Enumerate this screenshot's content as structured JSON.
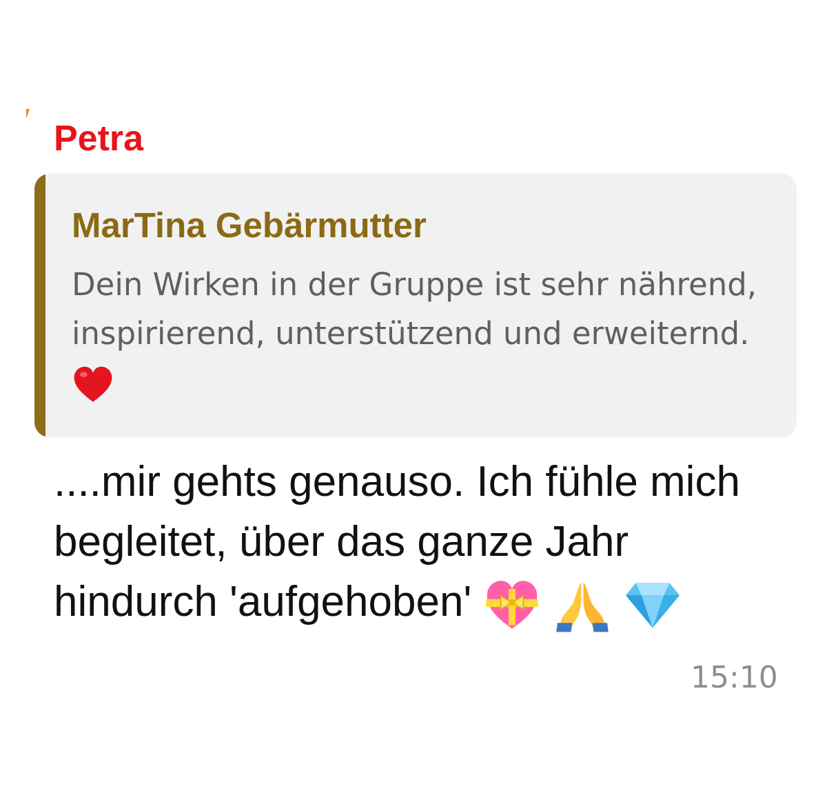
{
  "message": {
    "sender": "Petra",
    "sender_color": "#e8141a",
    "quote": {
      "author": "MarTina Gebärmutter",
      "author_color": "#8a6a14",
      "text": "Dein Wirken in der Gruppe ist sehr nährend, inspirierend, unterstützend und erweiternd.",
      "emoji": "red-heart-icon"
    },
    "text": "....mir gehts genauso. Ich fühle mich begleitet, über das ganze Jahr hindurch 'aufgehoben'",
    "emojis": [
      "heart-with-ribbon-icon",
      "folded-hands-icon",
      "gem-stone-icon"
    ],
    "time": "15:10"
  }
}
